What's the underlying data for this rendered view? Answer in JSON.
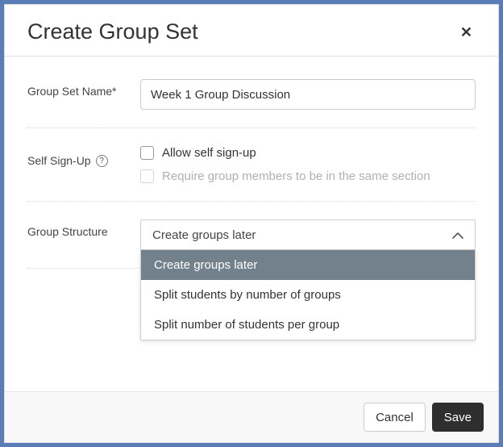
{
  "modal": {
    "title": "Create Group Set",
    "close_glyph": "✕"
  },
  "fields": {
    "name_label": "Group Set Name*",
    "name_value": "Week 1 Group Discussion",
    "signup_label": "Self Sign-Up",
    "signup_allow_label": "Allow self sign-up",
    "signup_same_section_label": "Require group members to be in the same section",
    "structure_label": "Group Structure"
  },
  "structure": {
    "selected": "Create groups later",
    "options": [
      "Create groups later",
      "Split students by number of groups",
      "Split number of students per group"
    ]
  },
  "footer": {
    "cancel_label": "Cancel",
    "save_label": "Save"
  }
}
